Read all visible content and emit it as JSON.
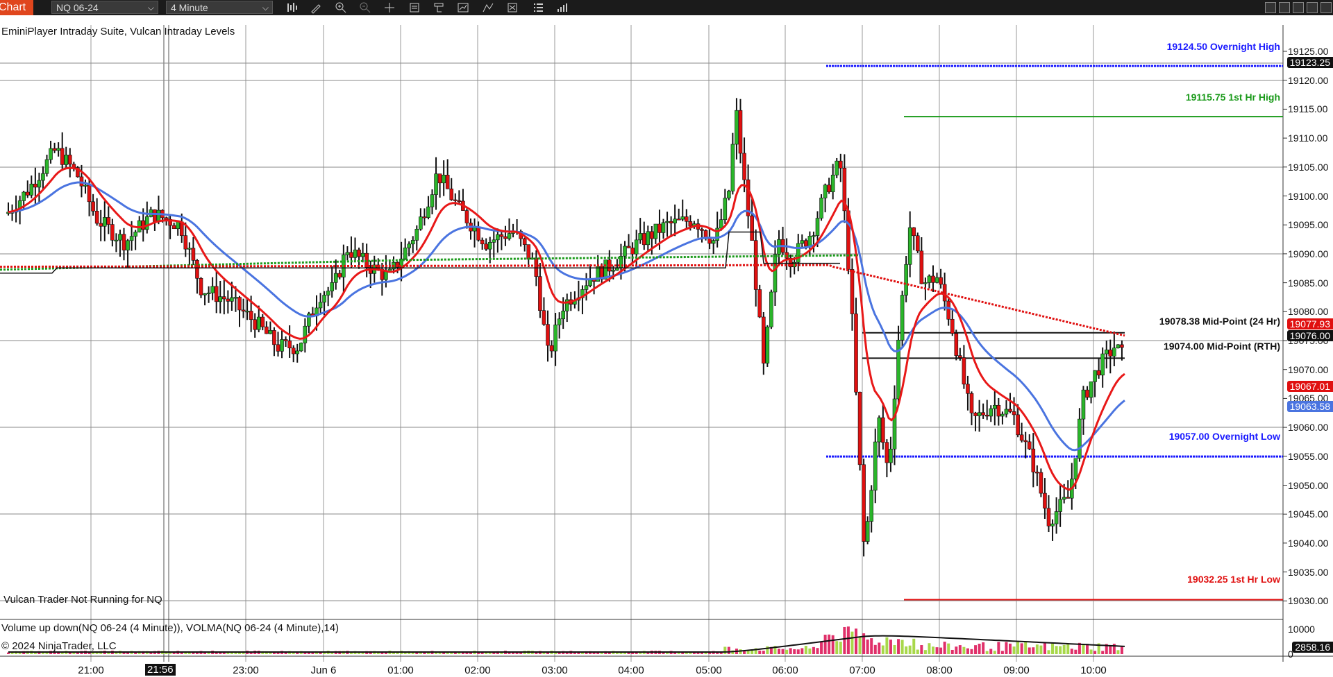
{
  "toolbar": {
    "chart_tab": "Chart",
    "instrument": "NQ 06-24",
    "interval": "4 Minute",
    "icons": [
      "bar-style-icon",
      "pencil-draw-icon",
      "zoom-in-icon",
      "zoom-out-icon",
      "crosshair-icon",
      "data-box-icon",
      "strategy-icon",
      "indicator-icon",
      "drawing-tool-icon",
      "properties-icon",
      "list-icon",
      "volume-bars-icon"
    ]
  },
  "indicators_label": "EminiPlayer Intraday Suite, Vulcan Intraday Levels",
  "vulcan_status": "Vulcan Trader Not Running for NQ",
  "volume_panel_label": "Volume up down(NQ 06-24 (4 Minute)), VOLMA(NQ 06-24 (4 Minute),14)",
  "copyright": "© 2024 NinjaTrader, LLC",
  "levels": {
    "overnight_high": "19124.50 Overnight High",
    "first_hr_high": "19115.75 1st Hr High",
    "mid_24": "19078.38 Mid-Point (24 Hr)",
    "mid_rth": "19074.00 Mid-Point (RTH)",
    "overnight_low": "19057.00 Overnight Low",
    "first_hr_low": "19032.25 1st Hr Low"
  },
  "price_tags": {
    "top": "19123.25",
    "red1": "19077.93",
    "black1": "19076.00",
    "red2": "19067.01",
    "blue": "19063.58",
    "volume": "2858.16"
  },
  "y_axis": [
    "19125.00",
    "19120.00",
    "19115.00",
    "19110.00",
    "19105.00",
    "19100.00",
    "19095.00",
    "19090.00",
    "19085.00",
    "19080.00",
    "19075.00",
    "19070.00",
    "19065.00",
    "19060.00",
    "19055.00",
    "19050.00",
    "19045.00",
    "19040.00",
    "19035.00",
    "19030.00"
  ],
  "volume_axis": [
    "10000",
    "0"
  ],
  "x_axis": [
    "21:00",
    "23:00",
    "Jun 6",
    "01:00",
    "02:00",
    "03:00",
    "04:00",
    "05:00",
    "06:00",
    "07:00",
    "08:00",
    "09:00",
    "10:00"
  ],
  "cursor_time": "21:56",
  "colors": {
    "up": "#2ab52a",
    "down": "#e01010",
    "ema_fast": "#e81818",
    "ema_slow": "#4a74e0",
    "overnight": "#1a1aff",
    "first_hr_high": "#1a9a1a",
    "first_hr_low": "#e01010"
  }
}
